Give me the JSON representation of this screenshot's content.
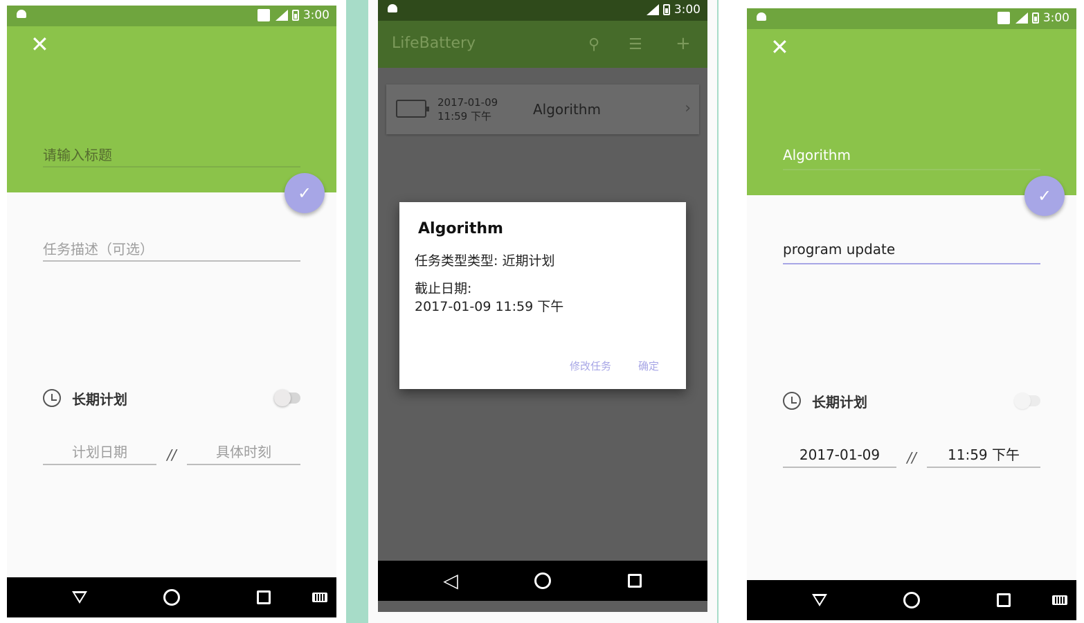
{
  "status": {
    "time": "3:00"
  },
  "screen_new": {
    "title_placeholder": "请输入标题",
    "desc_placeholder": "任务描述（可选）",
    "longterm_label": "长期计划",
    "date_placeholder": "计划日期",
    "separator": "//",
    "time_placeholder": "具体时刻",
    "fab_icon": "check-icon"
  },
  "screen_list": {
    "app_title": "LifeBattery",
    "card": {
      "date": "2017-01-09",
      "time": "11:59 下午",
      "title": "Algorithm"
    },
    "dialog": {
      "title": "Algorithm",
      "type_line": "任务类型类型: 近期计划",
      "deadline_label": "截止日期:",
      "deadline_value": "2017-01-09 11:59 下午",
      "edit_button": "修改任务",
      "ok_button": "确定"
    }
  },
  "screen_edit": {
    "title_value": "Algorithm",
    "desc_value": "program update",
    "longterm_label": "长期计划",
    "date_value": "2017-01-09",
    "separator": "//",
    "time_value": "11:59 下午"
  },
  "colors": {
    "green_header": "#8bc34a",
    "green_status": "#6fa53e",
    "accent_fab": "#a7a6e6",
    "dim_overlay": "#5e5e5e",
    "mint_frame": "#a7dcc8"
  }
}
